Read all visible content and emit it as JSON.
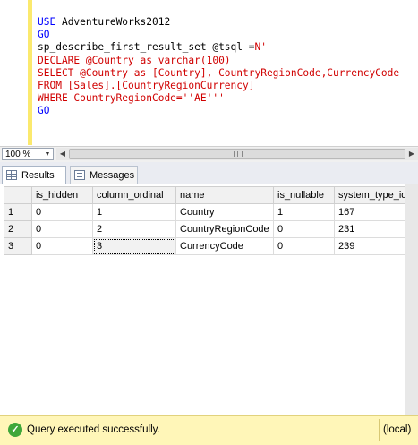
{
  "editor": {
    "lines": [
      [
        {
          "t": "USE ",
          "c": "kw"
        },
        {
          "t": "AdventureWorks2012",
          "c": "tx"
        }
      ],
      [
        {
          "t": "GO",
          "c": "kw"
        }
      ],
      [
        {
          "t": "sp_describe_first_result_set ",
          "c": "tx"
        },
        {
          "t": "@tsql ",
          "c": "tx"
        },
        {
          "t": "=",
          "c": "gray"
        },
        {
          "t": "N'",
          "c": "str"
        }
      ],
      [
        {
          "t": "DECLARE @Country as varchar(100)",
          "c": "str"
        }
      ],
      [
        {
          "t": "SELECT @Country as [Country], CountryRegionCode,CurrencyCode",
          "c": "str"
        }
      ],
      [
        {
          "t": "FROM [Sales].[CountryRegionCurrency]",
          "c": "str"
        }
      ],
      [
        {
          "t": "WHERE CountryRegionCode=''AE'''",
          "c": "str"
        }
      ],
      [
        {
          "t": "GO",
          "c": "kw"
        }
      ]
    ]
  },
  "zoom": {
    "value": "100 %"
  },
  "tabs": [
    {
      "label": "Results",
      "icon": "grid-icon"
    },
    {
      "label": "Messages",
      "icon": "messages-icon"
    }
  ],
  "grid": {
    "columns": [
      "",
      "is_hidden",
      "column_ordinal",
      "name",
      "is_nullable",
      "system_type_id"
    ],
    "rows": [
      [
        "1",
        "0",
        "1",
        "Country",
        "1",
        "167"
      ],
      [
        "2",
        "0",
        "2",
        "CountryRegionCode",
        "0",
        "231"
      ],
      [
        "3",
        "0",
        "3",
        "CurrencyCode",
        "0",
        "239"
      ]
    ],
    "selected_cell": {
      "row": 2,
      "col": 2
    }
  },
  "status": {
    "message": "Query executed successfully.",
    "server": "(local)",
    "icon": "success-check-icon",
    "background": "#fff6b8"
  },
  "colors": {
    "keyword": "#0000ff",
    "string": "#d00000",
    "margin_marker": "#fbe96e"
  }
}
